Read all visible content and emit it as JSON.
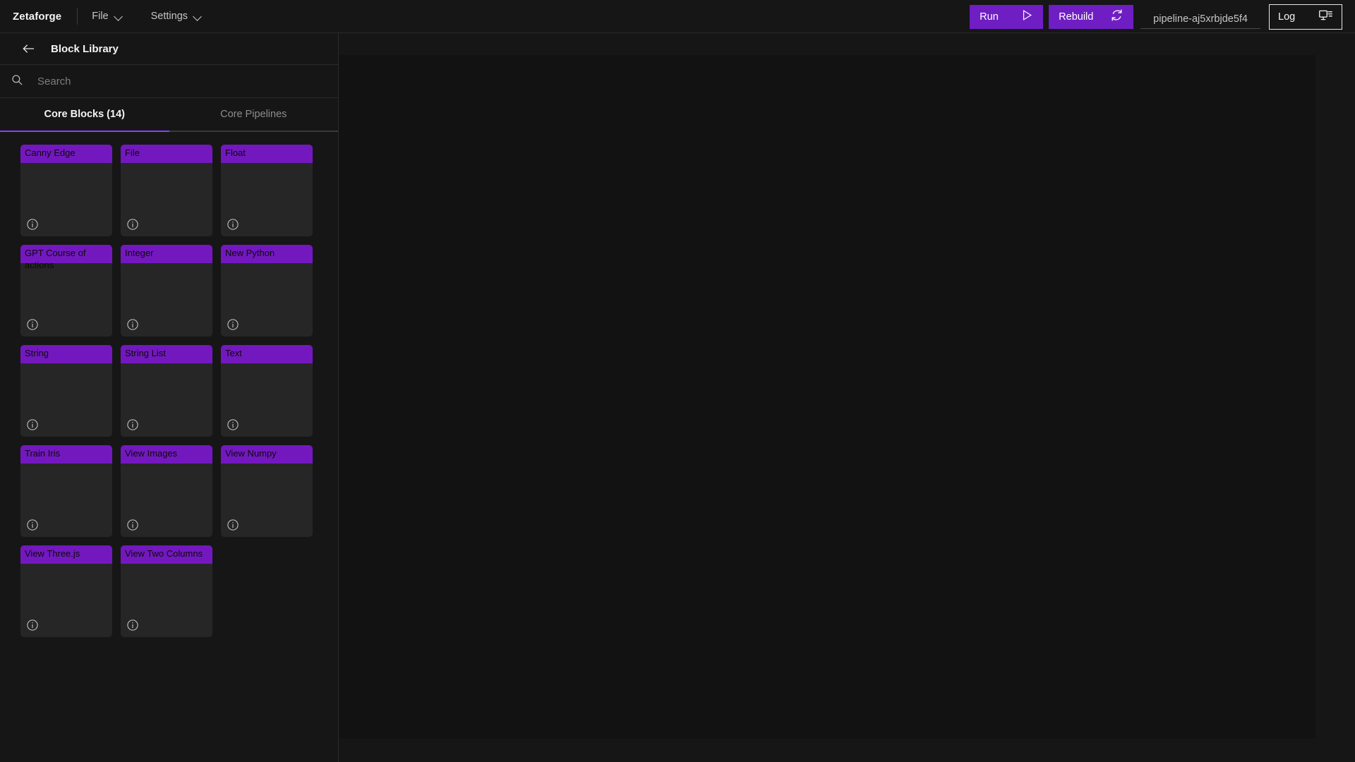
{
  "topbar": {
    "brand": "Zetaforge",
    "menus": [
      {
        "label": "File",
        "icon": "chevron-down-icon"
      },
      {
        "label": "Settings",
        "icon": "chevron-down-icon"
      }
    ],
    "run_label": "Run",
    "run_icon": "play-icon",
    "rebuild_label": "Rebuild",
    "rebuild_icon": "refresh-icon",
    "pipeline_name": "pipeline-aj5xrbjde5f4",
    "log_label": "Log",
    "log_icon": "monitor-icon",
    "accent_purple": "#7318bf",
    "background": "#161616"
  },
  "sidebar": {
    "back_icon": "arrow-left-icon",
    "title": "Block Library",
    "search": {
      "icon": "search-icon",
      "placeholder": "Search",
      "value": ""
    },
    "tabs": [
      {
        "label": "Core Blocks (14)",
        "active": true
      },
      {
        "label": "Core Pipelines",
        "active": false
      }
    ],
    "blocks": [
      {
        "title": "Canny Edge",
        "info_icon": "info-icon"
      },
      {
        "title": "File",
        "info_icon": "info-icon"
      },
      {
        "title": "Float",
        "info_icon": "info-icon"
      },
      {
        "title": "GPT Course of actions",
        "info_icon": "info-icon"
      },
      {
        "title": "Integer",
        "info_icon": "info-icon"
      },
      {
        "title": "New Python",
        "info_icon": "info-icon"
      },
      {
        "title": "String",
        "info_icon": "info-icon"
      },
      {
        "title": "String List",
        "info_icon": "info-icon"
      },
      {
        "title": "Text",
        "info_icon": "info-icon"
      },
      {
        "title": "Train Iris",
        "info_icon": "info-icon"
      },
      {
        "title": "View Images",
        "info_icon": "info-icon"
      },
      {
        "title": "View Numpy",
        "info_icon": "info-icon"
      },
      {
        "title": "View Three.js",
        "info_icon": "info-icon"
      },
      {
        "title": "View Two Columns",
        "info_icon": "info-icon"
      }
    ]
  },
  "canvas": {
    "background": "#121212",
    "content": ""
  }
}
